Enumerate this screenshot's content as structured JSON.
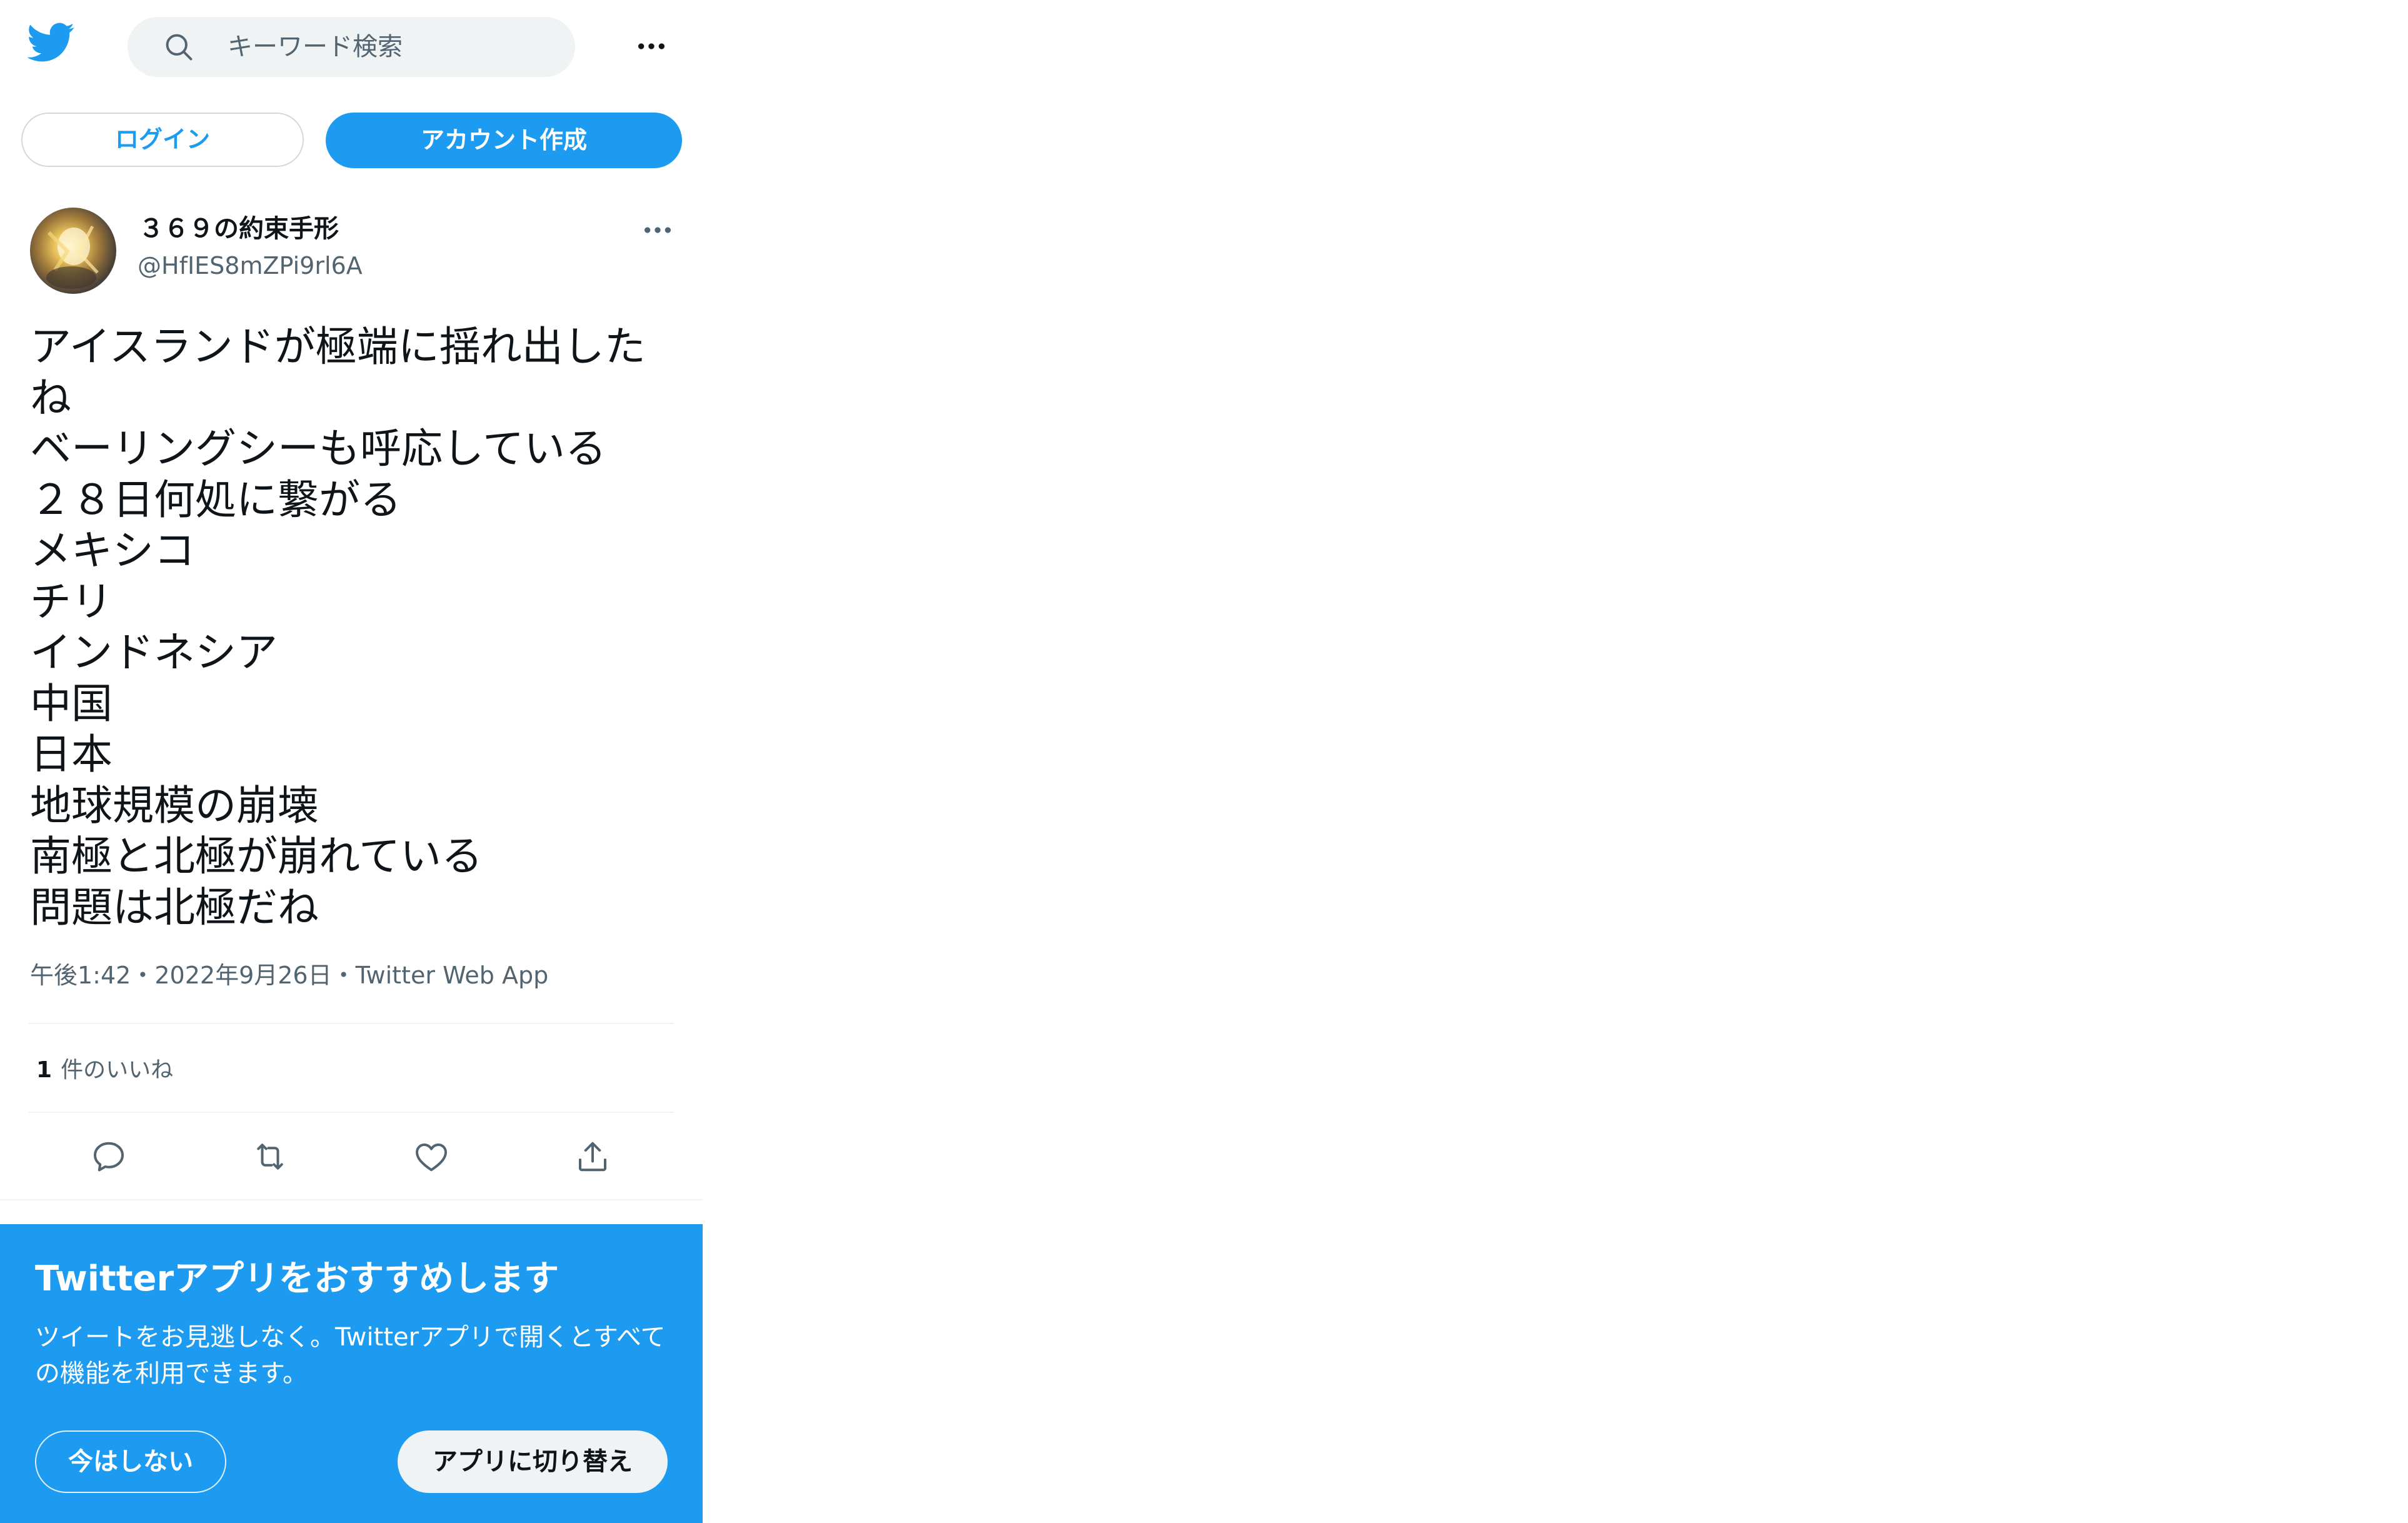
{
  "header": {
    "logo_icon": "twitter-bird-icon",
    "search_placeholder": "キーワード検索",
    "more_icon": "more-horizontal-icon"
  },
  "auth": {
    "login_label": "ログイン",
    "signup_label": "アカウント作成"
  },
  "tweet": {
    "author": {
      "display_name": "３６９の約束手形",
      "handle": "@HfIES8mZPi9rl6A"
    },
    "lines": [
      "アイスランドが極端に揺れ出した",
      "ね",
      "ベーリングシーも呼応している",
      "２８日何処に繋がる",
      "メキシコ",
      "チリ",
      "インドネシア",
      "中国",
      "日本",
      "地球規模の崩壊",
      "南極と北極が崩れている",
      "問題は北極だね"
    ],
    "time": "午後1:42",
    "date": "2022年9月26日",
    "source": "Twitter Web App",
    "separator": "・",
    "likes_count": "1",
    "likes_label": "件のいいね",
    "actions": [
      "reply-icon",
      "retweet-icon",
      "like-icon",
      "share-icon"
    ]
  },
  "app_banner": {
    "title": "Twitterアプリをおすすめします",
    "body": "ツイートをお見逃しなく。Twitterアプリで開くとすべての機能を利用できます。",
    "not_now_label": "今はしない",
    "switch_label": "アプリに切り替え"
  },
  "colors": {
    "accent": "#1d9bf0",
    "text_primary": "#0f1419",
    "text_secondary": "#536471",
    "border": "#cfd9de",
    "search_bg": "#eff3f4"
  }
}
